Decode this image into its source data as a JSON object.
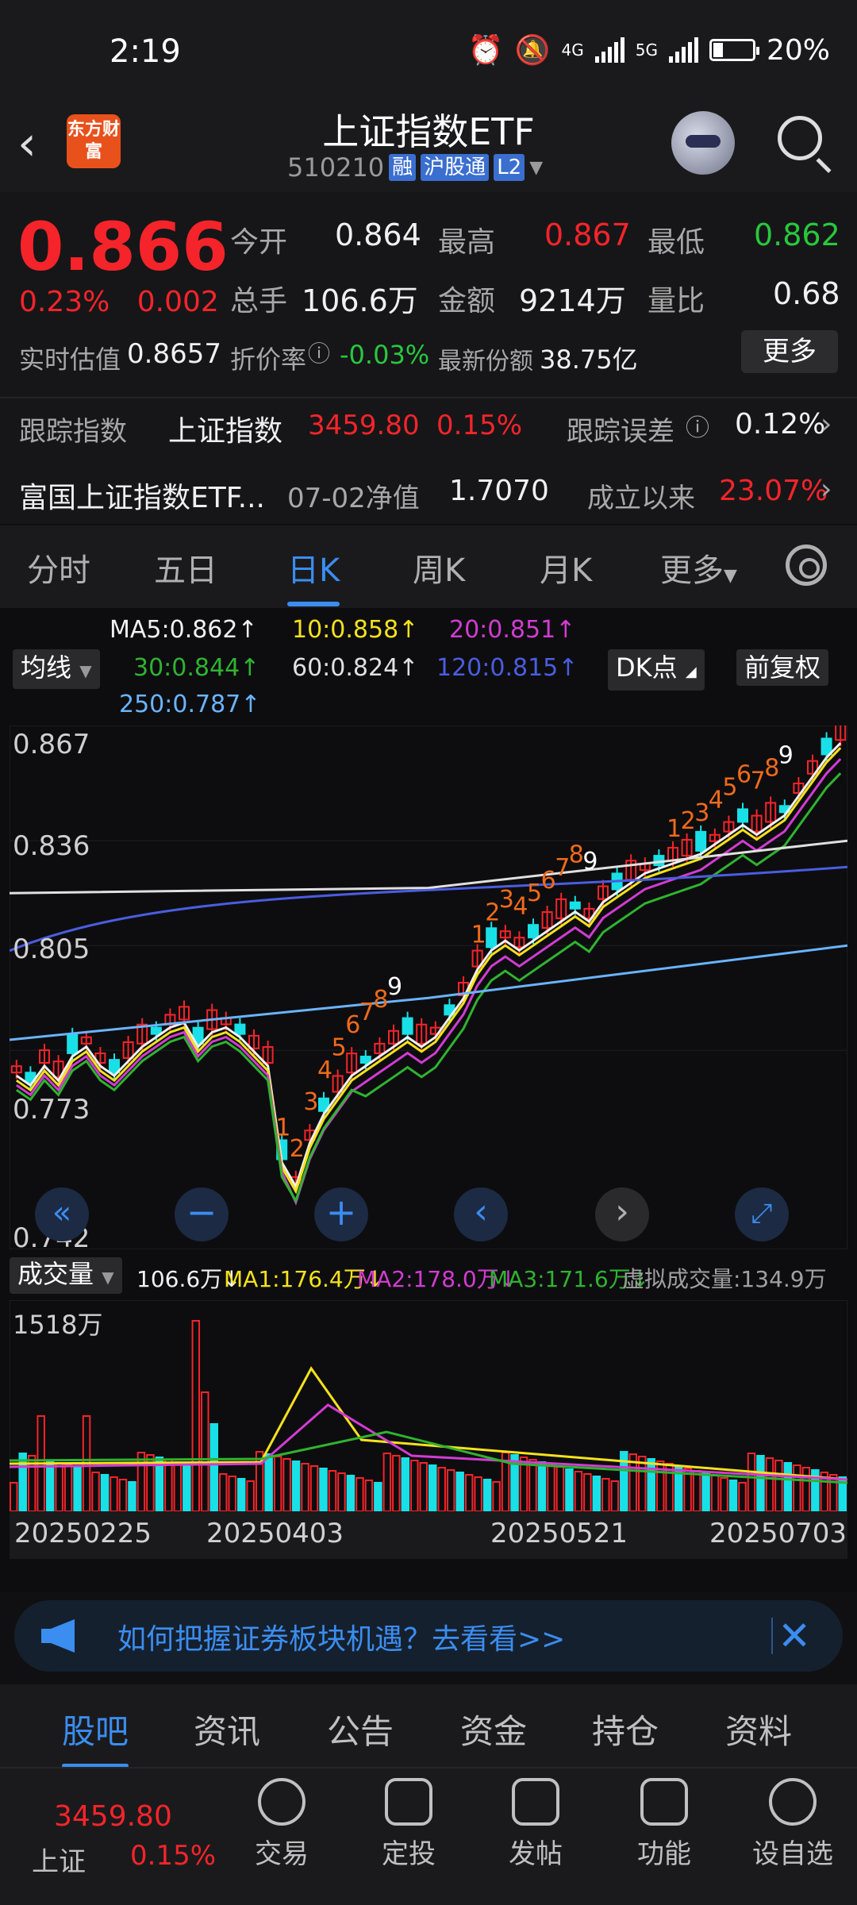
{
  "status": {
    "time": "2:19",
    "net1": "4G",
    "net2": "5G",
    "battery": "20%"
  },
  "header": {
    "back": "<",
    "logo": "东方财富",
    "title": "上证指数ETF",
    "code": "510210",
    "tags": [
      "融",
      "沪股通",
      "L2"
    ]
  },
  "quote": {
    "price": "0.866",
    "change_pct": "0.23%",
    "change": "0.002",
    "open_label": "今开",
    "open": "0.864",
    "high_label": "最高",
    "high": "0.867",
    "low_label": "最低",
    "low": "0.862",
    "volume_label": "总手",
    "volume": "106.6万",
    "amount_label": "金额",
    "amount": "9214万",
    "ratio_label": "量比",
    "ratio": "0.68",
    "iopv_label": "实时估值",
    "iopv": "0.8657",
    "discount_label": "折价率",
    "discount": "-0.03%",
    "shares_label": "最新份额",
    "shares": "38.75亿",
    "more": "更多"
  },
  "tracking": {
    "label": "跟踪指数",
    "index": "上证指数",
    "index_value": "3459.80",
    "index_pct": "0.15%",
    "error_label": "跟踪误差",
    "error": "0.12%"
  },
  "fund": {
    "name": "富国上证指数ETF...",
    "nav_label": "07-02净值",
    "nav": "1.7070",
    "since_label": "成立以来",
    "since": "23.07%"
  },
  "ktabs": [
    "分时",
    "五日",
    "日K",
    "周K",
    "月K",
    "更多"
  ],
  "ma_legend": {
    "ma5": "MA5:0.862↑",
    "ma10": "10:0.858↑",
    "ma20": "20:0.851↑",
    "ma30": "30:0.844↑",
    "ma60": "60:0.824↑",
    "ma120": "120:0.815↑",
    "ma250": "250:0.787↑",
    "chip_ma": "均线",
    "chip_dk": "DK点",
    "chip_adj": "前复权"
  },
  "price_axis": [
    "0.867",
    "0.836",
    "0.805",
    "0.773",
    "0.742"
  ],
  "td_marks": [
    "1",
    "2",
    "3",
    "4",
    "5",
    "6",
    "7",
    "8",
    "9"
  ],
  "volume_legend": {
    "chip": "成交量",
    "vol": "106.6万↓",
    "ma1": "MA1:176.4万↓",
    "ma2": "MA2:178.0万↓",
    "ma3": "MA3:171.6万↓",
    "virtual": "虚拟成交量:134.9万",
    "max": "1518万"
  },
  "dates": [
    "20250225",
    "20250403",
    "20250521",
    "20250703"
  ],
  "banner": {
    "text": "如何把握证券板块机遇？去看看>>"
  },
  "btabs": [
    "股吧",
    "资讯",
    "公告",
    "资金",
    "持仓",
    "资料"
  ],
  "bottombar": {
    "index_value": "3459.80",
    "index_name": "上证",
    "index_pct": "0.15%",
    "items": [
      "交易",
      "定投",
      "发帖",
      "功能",
      "设自选"
    ]
  },
  "colors": {
    "up": "#f5242a",
    "down": "#28c83d",
    "accent": "#3b8df0"
  }
}
